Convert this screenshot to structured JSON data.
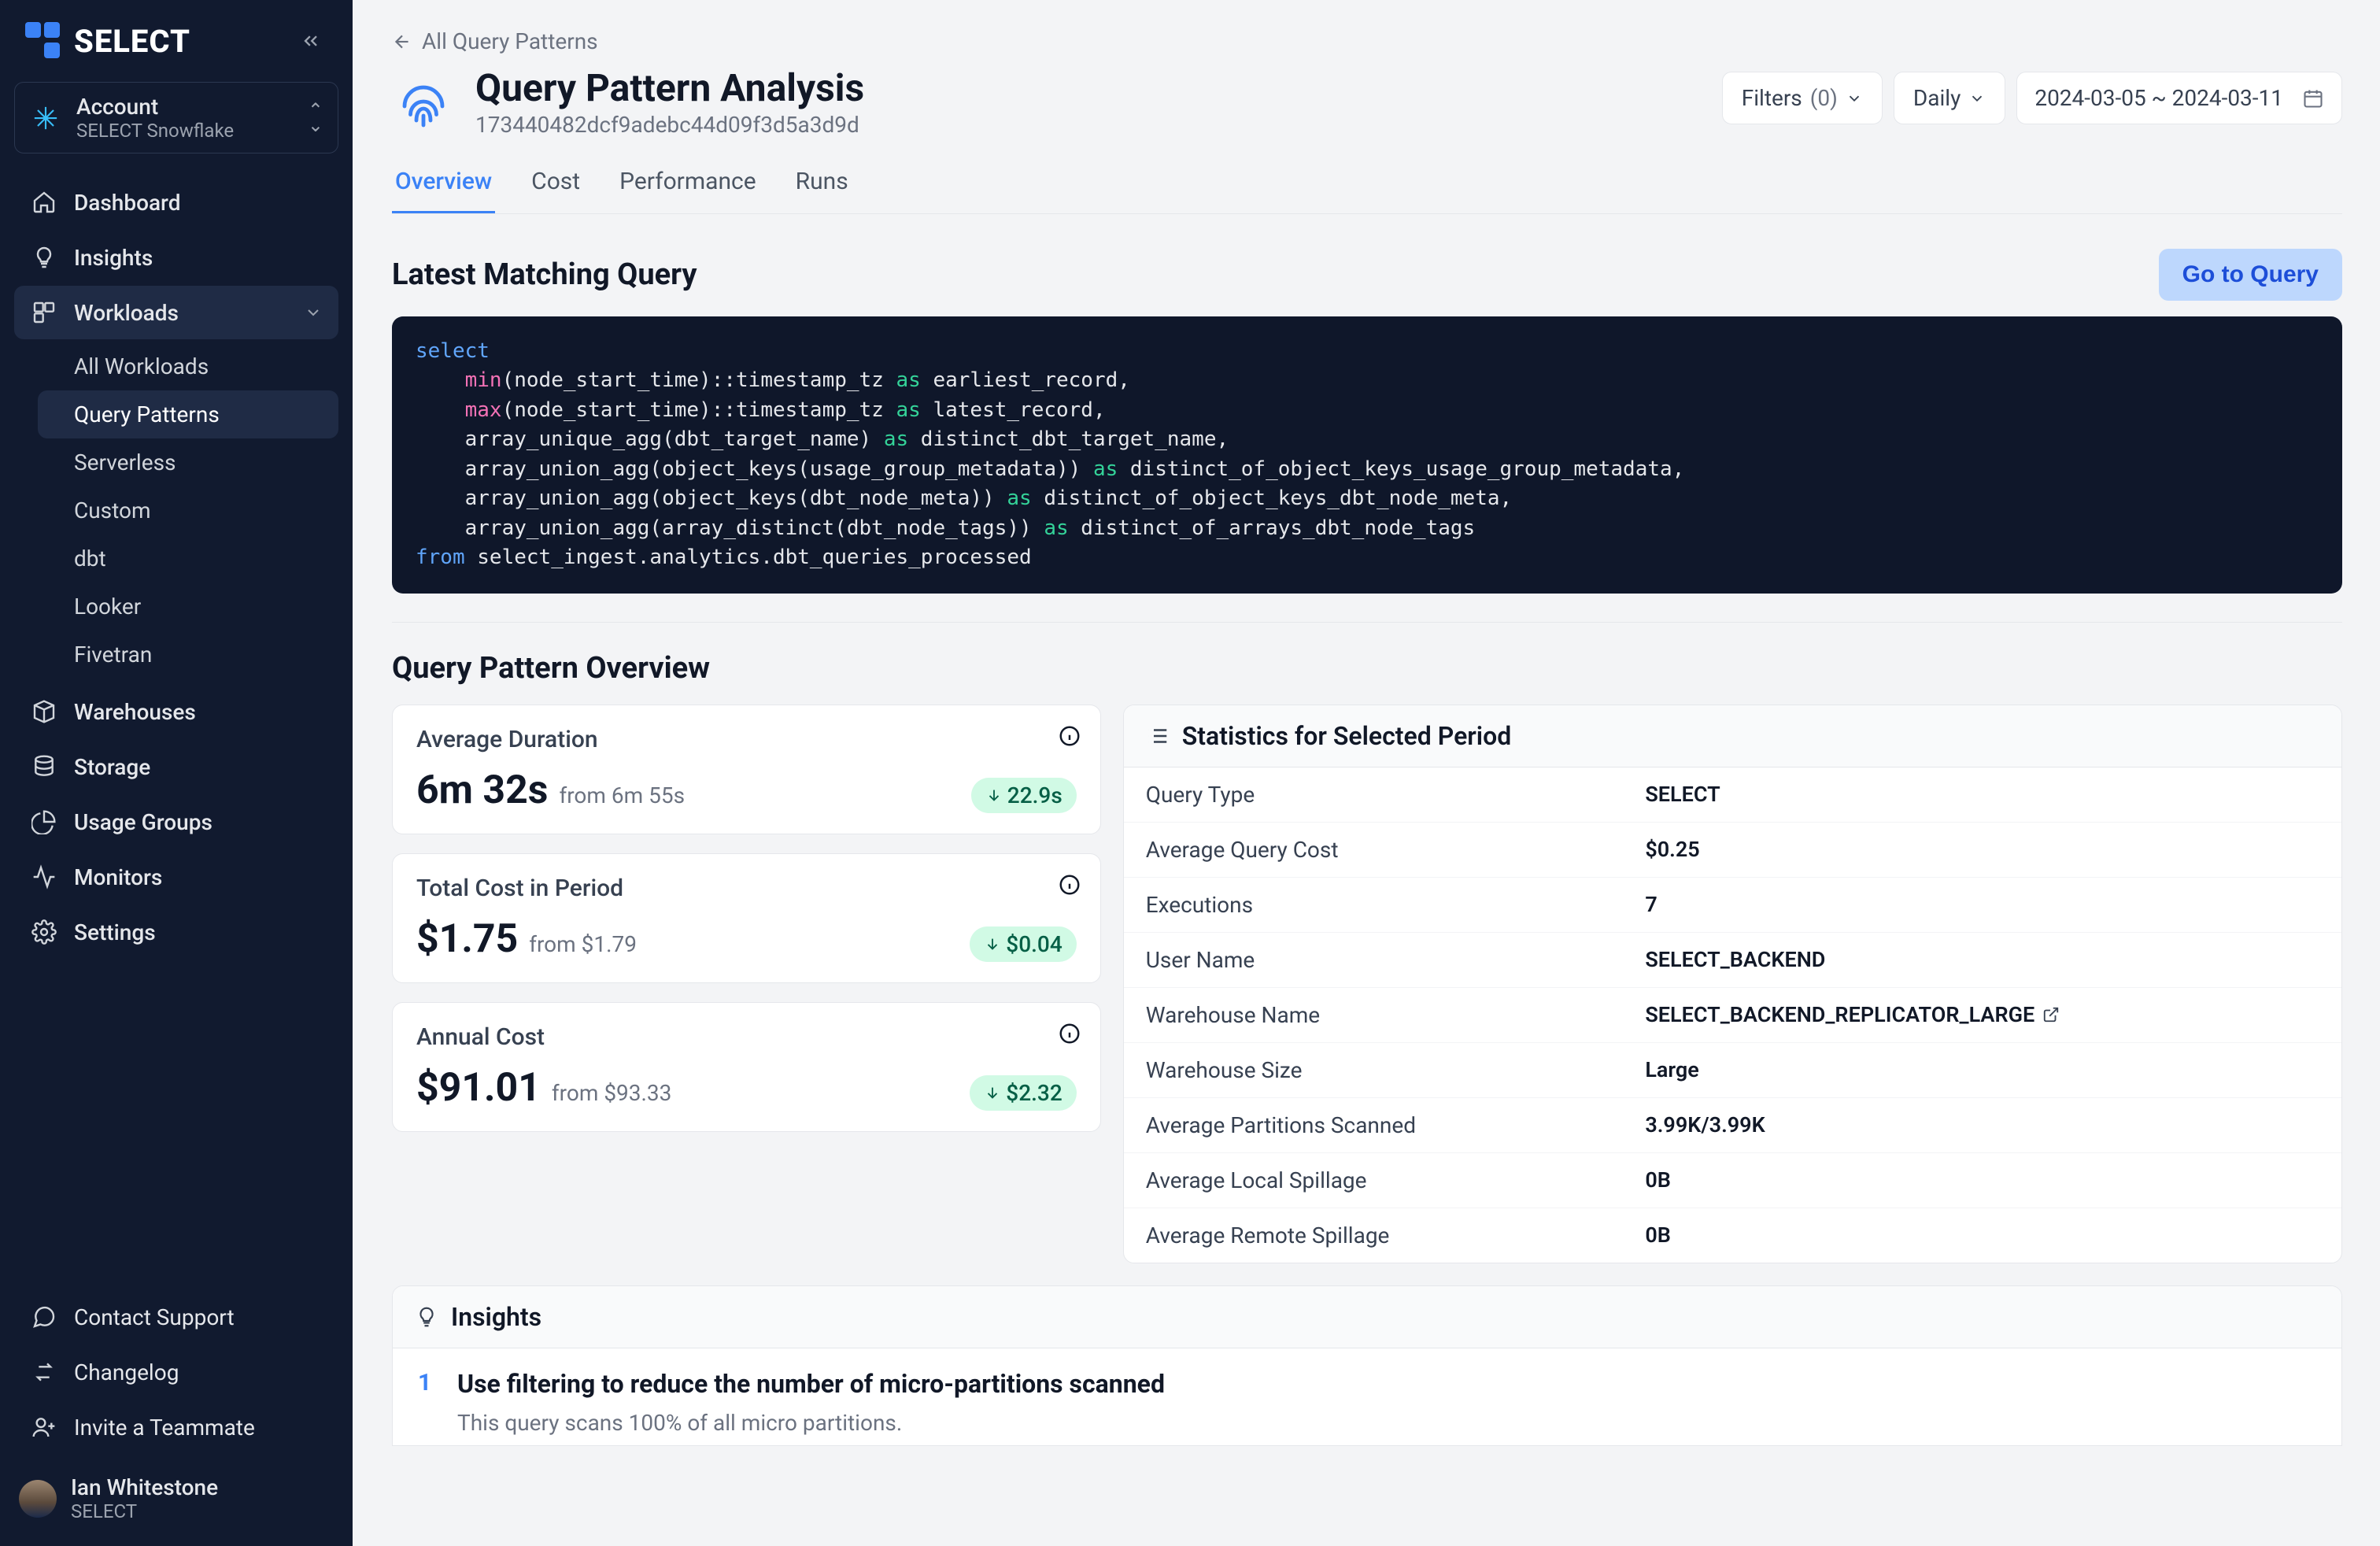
{
  "brand": {
    "name": "SELECT"
  },
  "account": {
    "label": "Account",
    "name": "SELECT Snowflake"
  },
  "sidebar": {
    "items": [
      {
        "label": "Dashboard"
      },
      {
        "label": "Insights"
      },
      {
        "label": "Workloads"
      },
      {
        "label": "Warehouses"
      },
      {
        "label": "Storage"
      },
      {
        "label": "Usage Groups"
      },
      {
        "label": "Monitors"
      },
      {
        "label": "Settings"
      }
    ],
    "workloads_sub": [
      {
        "label": "All Workloads"
      },
      {
        "label": "Query Patterns"
      },
      {
        "label": "Serverless"
      },
      {
        "label": "Custom"
      },
      {
        "label": "dbt"
      },
      {
        "label": "Looker"
      },
      {
        "label": "Fivetran"
      }
    ],
    "bottom": [
      {
        "label": "Contact Support"
      },
      {
        "label": "Changelog"
      },
      {
        "label": "Invite a Teammate"
      }
    ]
  },
  "user": {
    "name": "Ian Whitestone",
    "org": "SELECT"
  },
  "back_link": "All Query Patterns",
  "page": {
    "title": "Query Pattern Analysis",
    "hash": "173440482dcf9adebc44d09f3d5a3d9d"
  },
  "controls": {
    "filters_label": "Filters",
    "filters_count": "(0)",
    "cadence_label": "Daily",
    "date_range": "2024-03-05 ~ 2024-03-11"
  },
  "tabs": [
    {
      "label": "Overview"
    },
    {
      "label": "Cost"
    },
    {
      "label": "Performance"
    },
    {
      "label": "Runs"
    }
  ],
  "latest_query": {
    "heading": "Latest Matching Query",
    "go_button": "Go to Query"
  },
  "overview": {
    "heading": "Query Pattern Overview",
    "cards": [
      {
        "label": "Average Duration",
        "value": "6m 32s",
        "from": "from 6m 55s",
        "delta": "22.9s"
      },
      {
        "label": "Total Cost in Period",
        "value": "$1.75",
        "from": "from $1.79",
        "delta": "$0.04"
      },
      {
        "label": "Annual Cost",
        "value": "$91.01",
        "from": "from $93.33",
        "delta": "$2.32"
      }
    ],
    "stats_heading": "Statistics for Selected Period",
    "stats": [
      {
        "k": "Query Type",
        "v": "SELECT"
      },
      {
        "k": "Average Query Cost",
        "v": "$0.25"
      },
      {
        "k": "Executions",
        "v": "7"
      },
      {
        "k": "User Name",
        "v": "SELECT_BACKEND"
      },
      {
        "k": "Warehouse Name",
        "v": "SELECT_BACKEND_REPLICATOR_LARGE",
        "link": true
      },
      {
        "k": "Warehouse Size",
        "v": "Large"
      },
      {
        "k": "Average Partitions Scanned",
        "v": "3.99K/3.99K"
      },
      {
        "k": "Average Local Spillage",
        "v": "0B"
      },
      {
        "k": "Average Remote Spillage",
        "v": "0B"
      }
    ]
  },
  "insights": {
    "heading": "Insights",
    "items": [
      {
        "num": "1",
        "title": "Use filtering to reduce the number of micro-partitions scanned",
        "body": "This query scans 100% of all micro partitions."
      }
    ]
  },
  "colors": {
    "accent": "#3B82F6",
    "positive_bg": "#D1FAE5",
    "positive_fg": "#065F46"
  }
}
